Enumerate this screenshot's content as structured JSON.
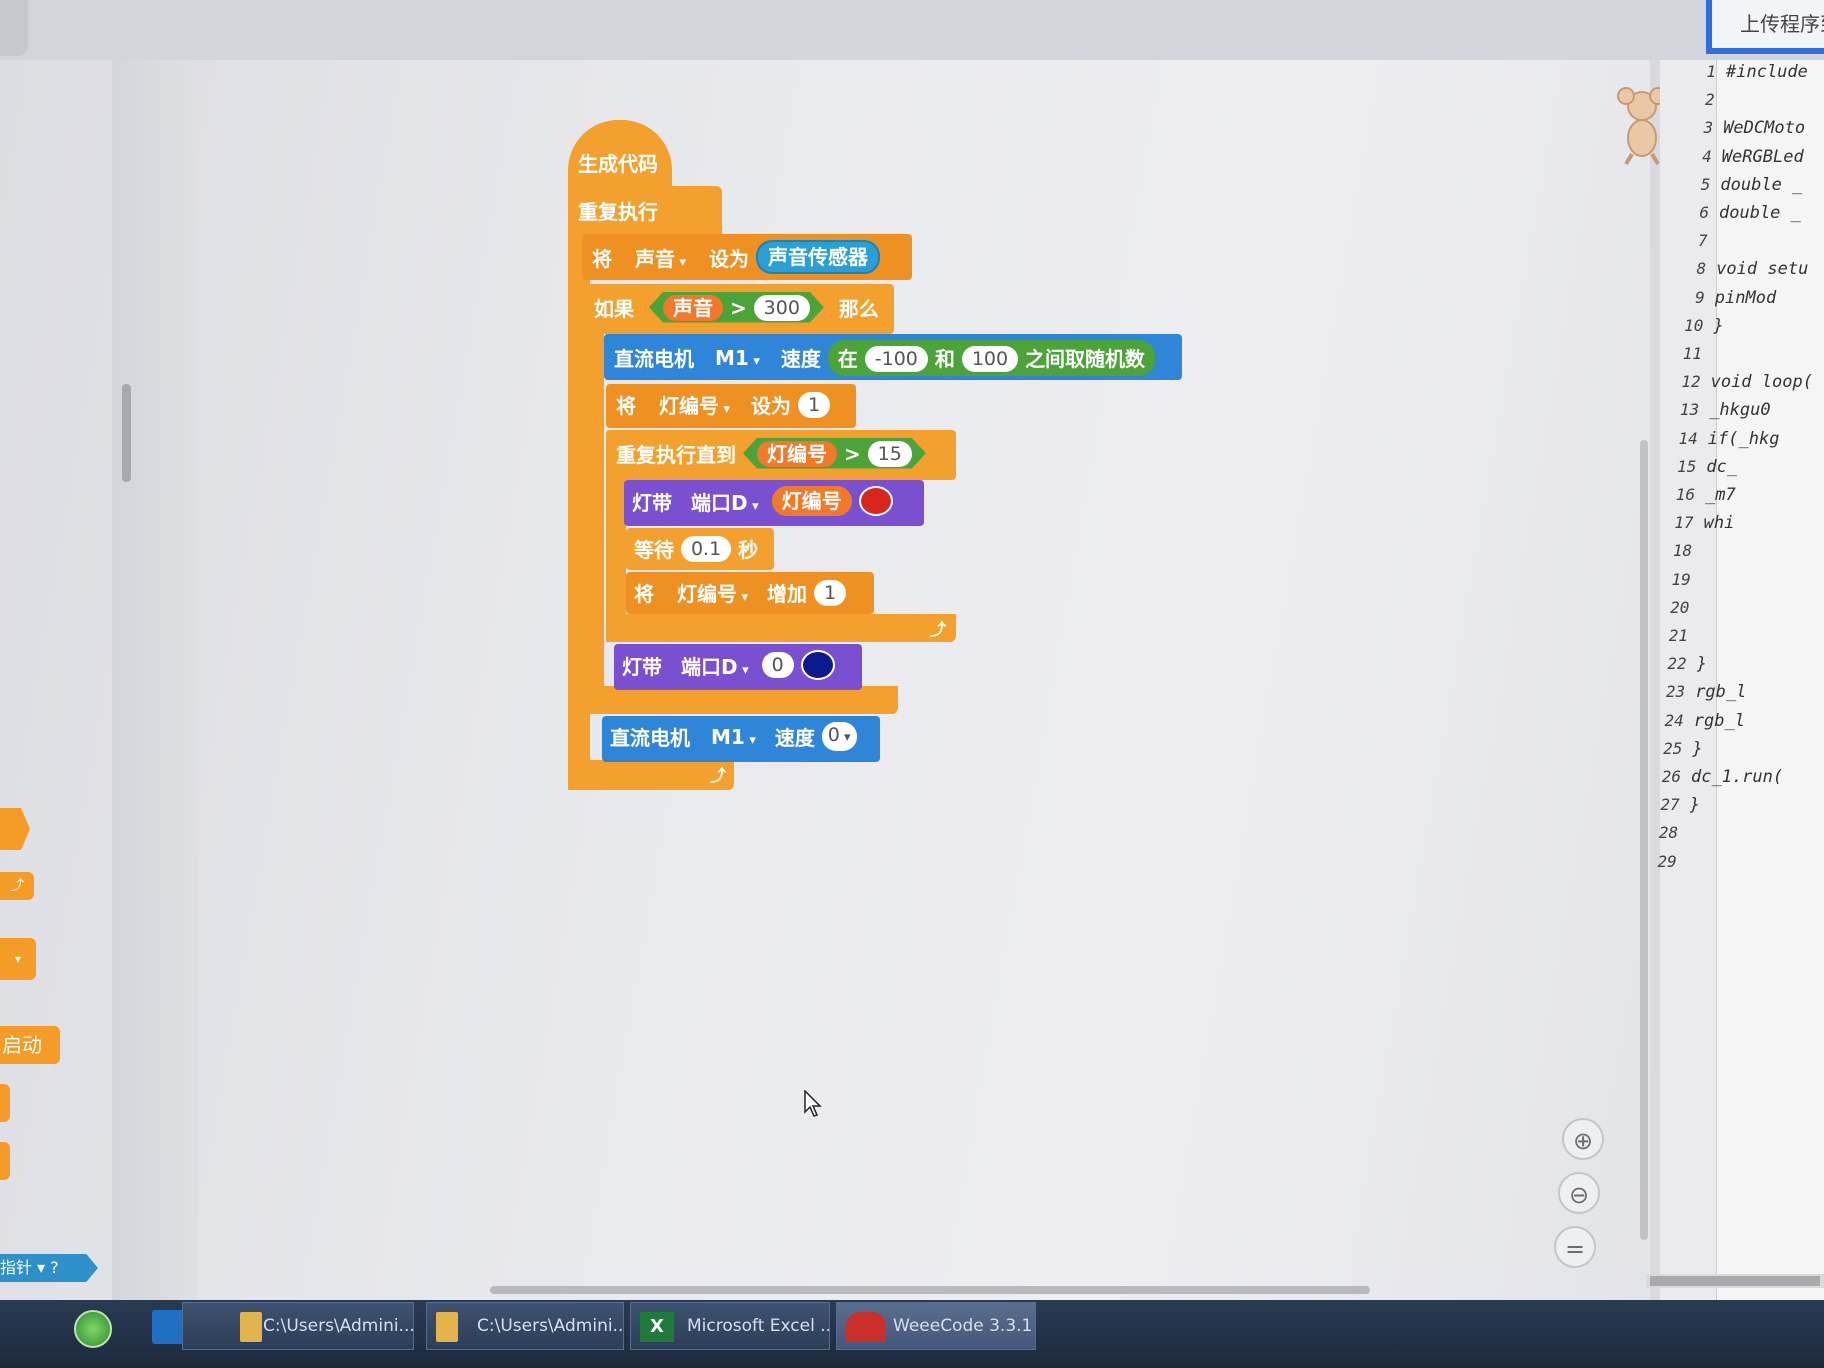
{
  "toolbar": {
    "upload_label": "上传程序到"
  },
  "palette": {
    "event_stub": "启动时",
    "variable_stub": "指针",
    "help": "?"
  },
  "blocks": {
    "hat": "生成代码",
    "forever": "重复执行",
    "set1": {
      "prefix": "将",
      "var": "声音",
      "mid": "设为",
      "sensor": "声音传感器"
    },
    "if": {
      "prefix": "如果",
      "var": "声音",
      "op": ">",
      "value": "300",
      "suffix": "那么"
    },
    "motor1": {
      "label": "直流电机",
      "port": "M1",
      "speed": "速度",
      "rand_prefix": "在",
      "min": "-100",
      "and": "和",
      "max": "100",
      "rand_suffix": "之间取随机数"
    },
    "set2": {
      "prefix": "将",
      "var": "灯编号",
      "mid": "设为",
      "value": "1"
    },
    "repeat_until": {
      "label": "重复执行直到",
      "var": "灯编号",
      "op": ">",
      "value": "15"
    },
    "led1": {
      "label": "灯带",
      "port": "端口D",
      "index_var": "灯编号",
      "color": "#d9261c"
    },
    "wait": {
      "label": "等待",
      "value": "0.1",
      "unit": "秒"
    },
    "change": {
      "prefix": "将",
      "var": "灯编号",
      "mid": "增加",
      "value": "1"
    },
    "led2": {
      "label": "灯带",
      "port": "端口D",
      "index": "0",
      "color": "#0b1a8c"
    },
    "motor2": {
      "label": "直流电机",
      "port": "M1",
      "speed": "速度",
      "value": "0"
    }
  },
  "code": {
    "lines": [
      {
        "n": "1",
        "t": "#include"
      },
      {
        "n": "2",
        "t": ""
      },
      {
        "n": "3",
        "t": "WeDCMoto"
      },
      {
        "n": "4",
        "t": "WeRGBLed"
      },
      {
        "n": "5",
        "t": "double _"
      },
      {
        "n": "6",
        "t": "double _"
      },
      {
        "n": "7",
        "t": ""
      },
      {
        "n": "8",
        "t": "void setu"
      },
      {
        "n": "9",
        "t": "    pinMod"
      },
      {
        "n": "10",
        "t": "}"
      },
      {
        "n": "11",
        "t": ""
      },
      {
        "n": "12",
        "t": "void loop("
      },
      {
        "n": "13",
        "t": "    _hkgu0"
      },
      {
        "n": "14",
        "t": "    if(_hkg"
      },
      {
        "n": "15",
        "t": "        dc_"
      },
      {
        "n": "16",
        "t": "        _m7"
      },
      {
        "n": "17",
        "t": "        whi"
      },
      {
        "n": "18",
        "t": ""
      },
      {
        "n": "19",
        "t": ""
      },
      {
        "n": "20",
        "t": ""
      },
      {
        "n": "21",
        "t": ""
      },
      {
        "n": "22",
        "t": "        }"
      },
      {
        "n": "23",
        "t": "        rgb_l"
      },
      {
        "n": "24",
        "t": "        rgb_l"
      },
      {
        "n": "25",
        "t": "    }"
      },
      {
        "n": "26",
        "t": "    dc_1.run("
      },
      {
        "n": "27",
        "t": "}"
      },
      {
        "n": "28",
        "t": ""
      },
      {
        "n": "29",
        "t": ""
      }
    ]
  },
  "taskbar": {
    "items": [
      "C:\\Users\\Admini...",
      "C:\\Users\\Admini...",
      "Microsoft Excel ...",
      "WeeeCode 3.3.1"
    ]
  }
}
